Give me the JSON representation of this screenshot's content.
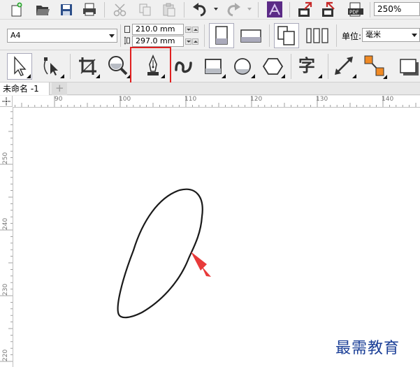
{
  "toolbar": {
    "zoom_value": "250%"
  },
  "propbar": {
    "page_size": "A4",
    "width_value": "210.0 mm",
    "height_value": "297.0 mm",
    "units_label": "单位:",
    "units_value": "毫米"
  },
  "tabs": {
    "document_tab": "未命名 -1",
    "add_tab": "+"
  },
  "rulers": {
    "top_labels": [
      "90",
      "100",
      "110",
      "120",
      "130",
      "140"
    ],
    "left_labels": [
      "250",
      "240",
      "230",
      "220"
    ]
  },
  "toolbox": {
    "text_tool_glyph": "字"
  },
  "watermark": "最需教育",
  "colors": {
    "highlight_box": "#e02020",
    "annotation_arrow": "#e83a3a",
    "toolbar_bg": "#f0f0f0",
    "watermark": "#1b3f97"
  }
}
